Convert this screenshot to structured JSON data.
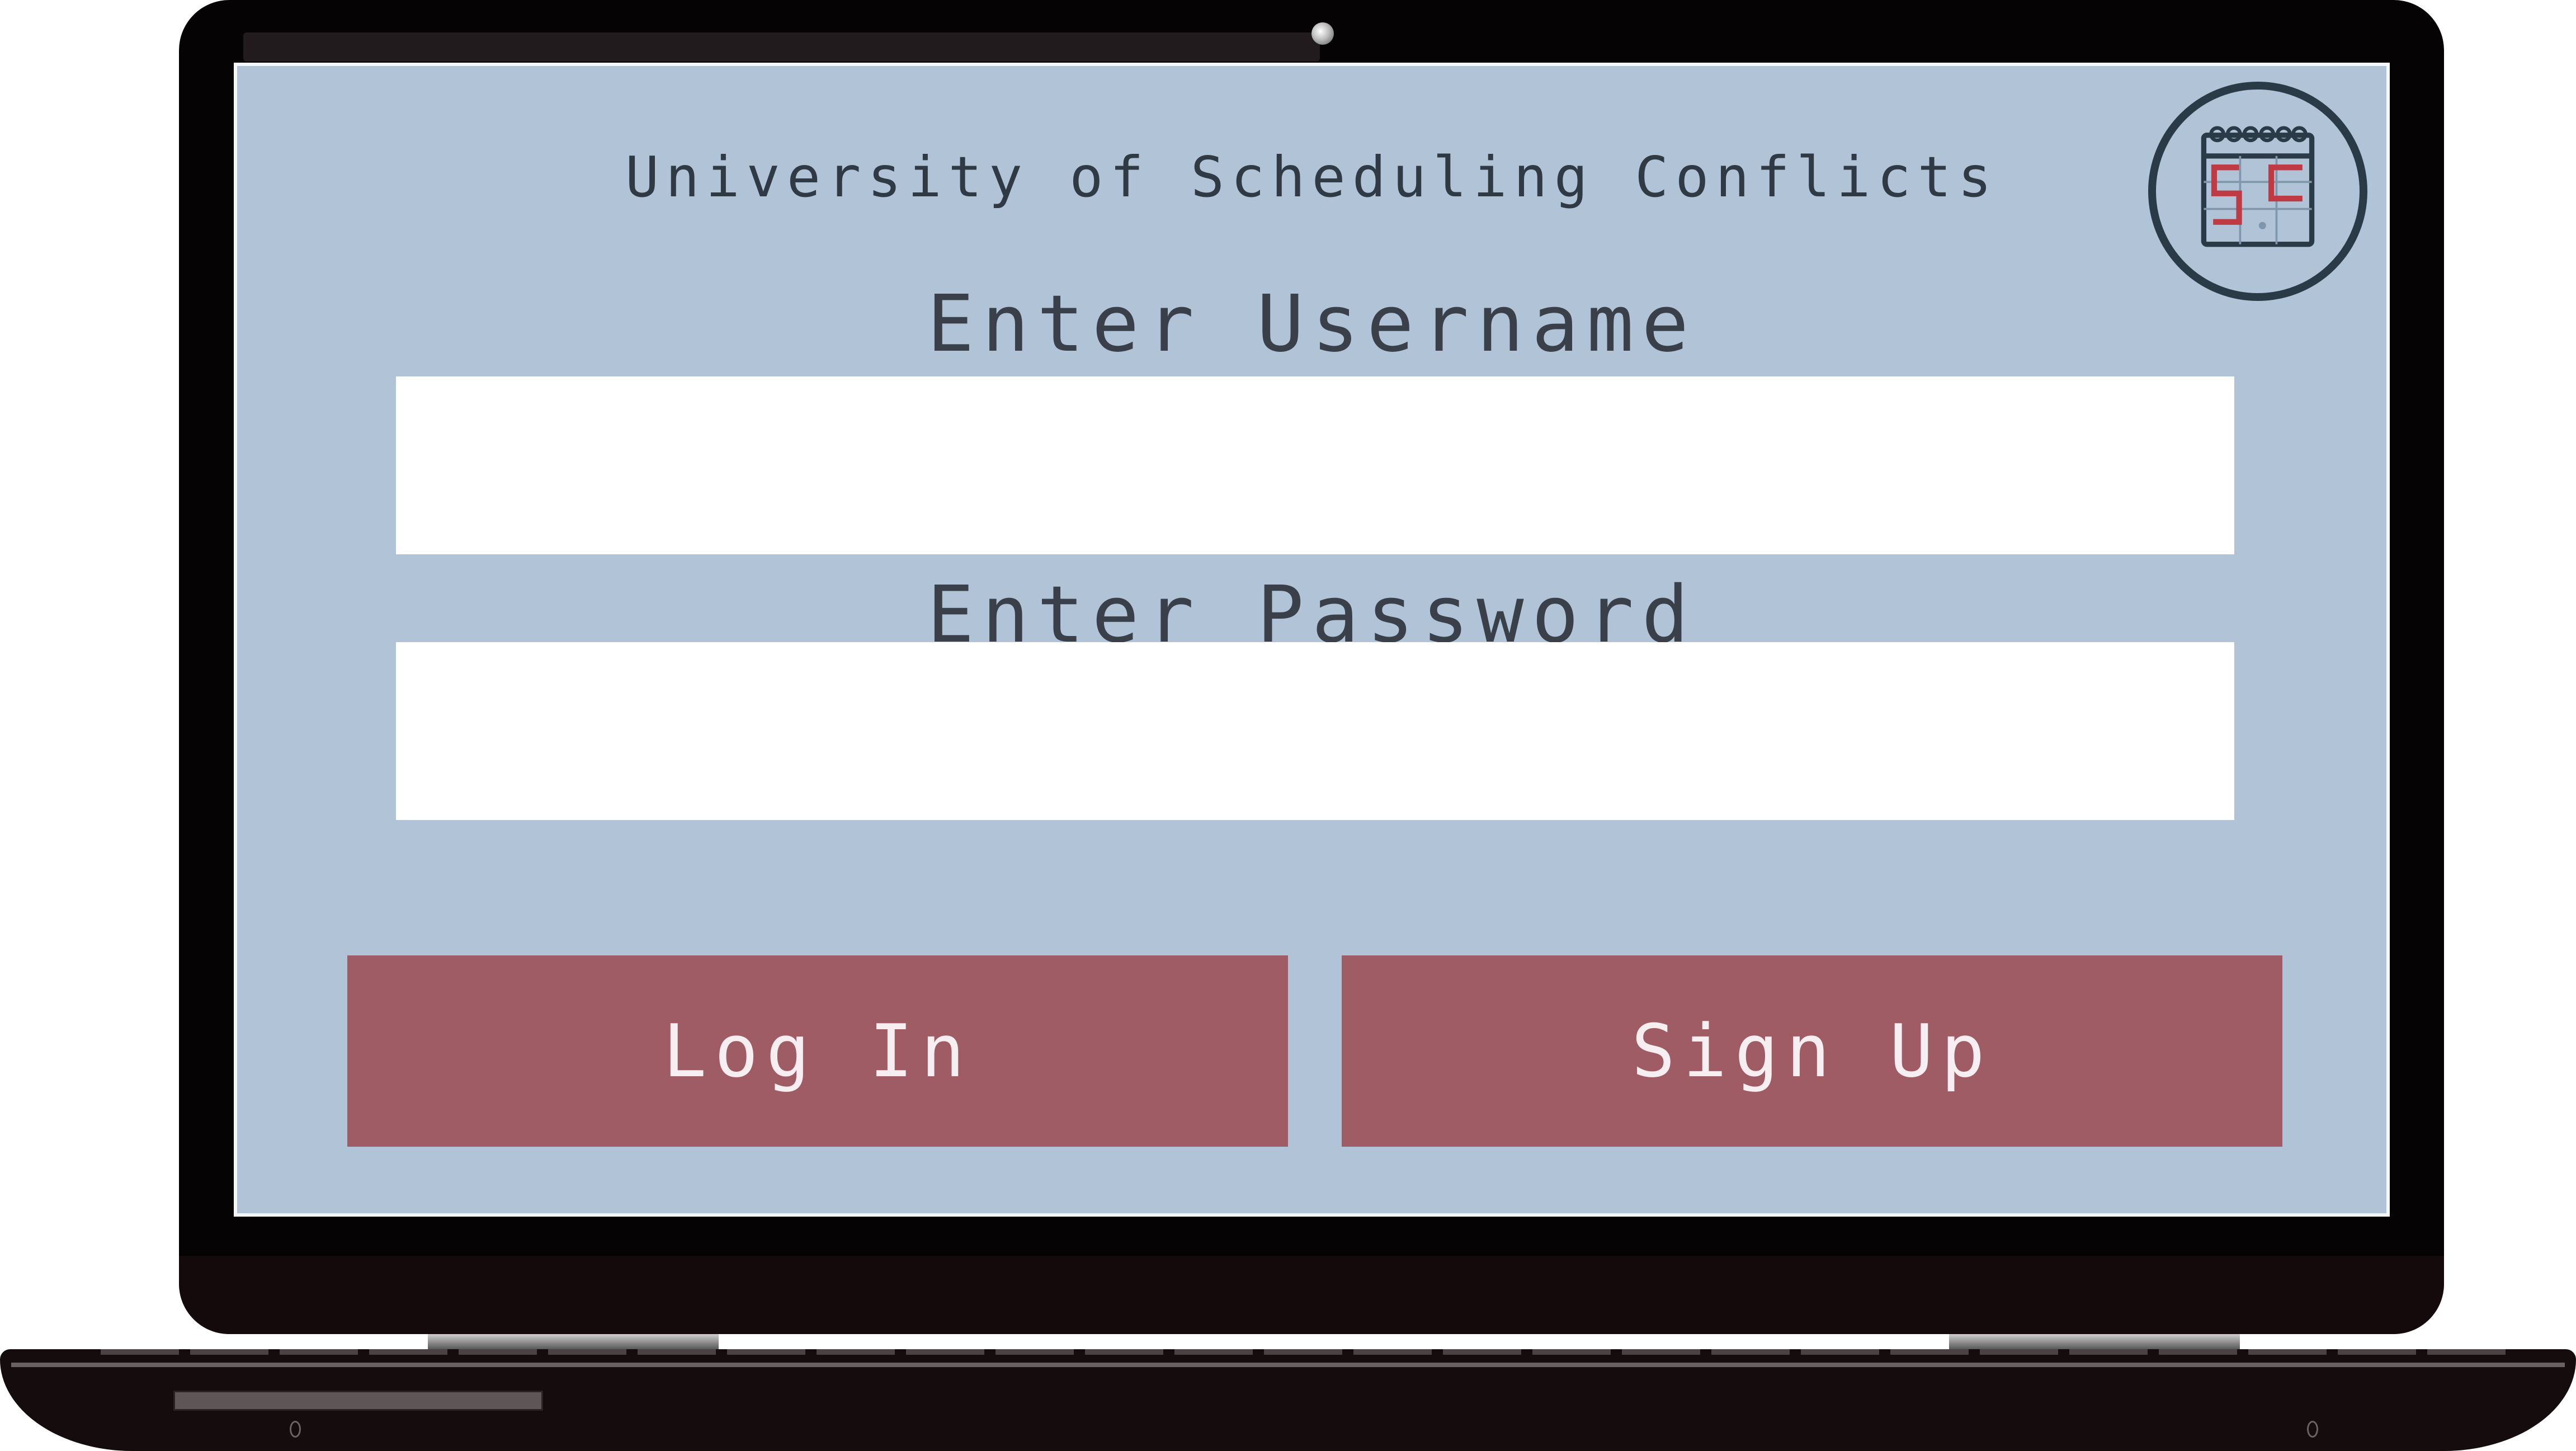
{
  "app": {
    "title": "University of Scheduling Conflicts",
    "logo_icon": "calendar-icon",
    "logo_monogram": "SC"
  },
  "login_form": {
    "username_label": "Enter Username",
    "username_value": "",
    "password_label": "Enter Password",
    "password_value": ""
  },
  "actions": {
    "login_label": "Log In",
    "signup_label": "Sign Up"
  },
  "colors": {
    "screen_background": "#b0c3d7",
    "button_accent": "#a05c64",
    "logo_ring": "#2b3a47",
    "logo_accent": "#c03a44"
  }
}
